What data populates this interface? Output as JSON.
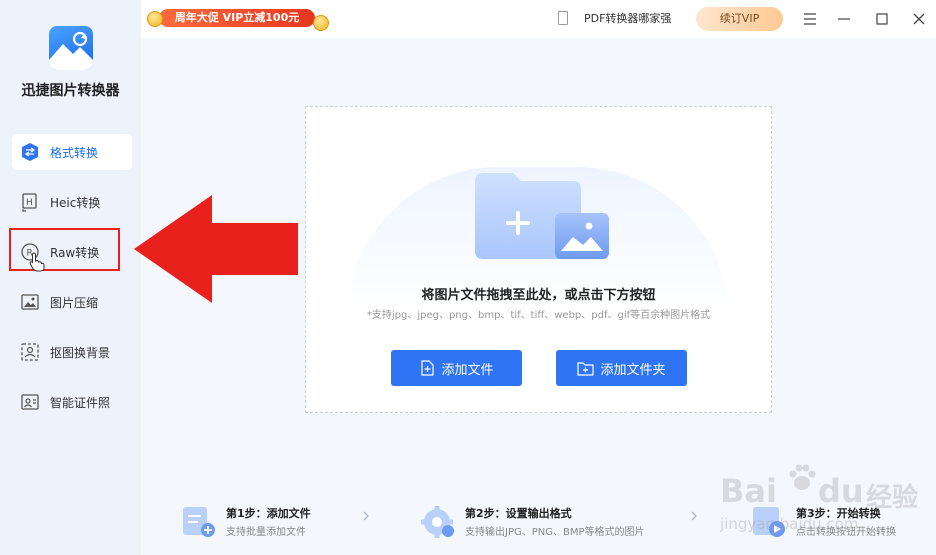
{
  "app": {
    "name": "迅捷图片转换器"
  },
  "sidebar": {
    "items": [
      {
        "label": "格式转换",
        "icon": "swap-icon",
        "active": true
      },
      {
        "label": "Heic转换",
        "icon": "heic-icon"
      },
      {
        "label": "Raw转换",
        "icon": "raw-icon"
      },
      {
        "label": "图片压缩",
        "icon": "image-compress-icon"
      },
      {
        "label": "抠图换背景",
        "icon": "cutout-icon"
      },
      {
        "label": "智能证件照",
        "icon": "id-photo-icon"
      }
    ]
  },
  "topbar": {
    "promo": "周年大促 VIP立减100元",
    "pdf_link": "PDF转换器哪家强",
    "vip_button": "续订VIP"
  },
  "dropzone": {
    "title": "将图片文件拖拽至此处，或点击下方按钮",
    "subtitle": "*支持jpg、jpeg、png、bmp、tif、tiff、webp、pdf、gif等百余种图片格式",
    "add_file": "添加文件",
    "add_folder": "添加文件夹"
  },
  "steps": [
    {
      "title": "第1步：添加文件",
      "desc": "支持批量添加文件"
    },
    {
      "title": "第2步：设置输出格式",
      "desc": "支持输出JPG、PNG、BMP等格式的图片"
    },
    {
      "title": "第3步：开始转换",
      "desc": "点击转换按钮开始转换"
    }
  ],
  "watermark": {
    "brand": "Bai",
    "brand2": "du",
    "cn": "经验",
    "url": "jingyan.baidu.com"
  },
  "colors": {
    "accent": "#2f74f5",
    "arrow": "#e8211d"
  }
}
